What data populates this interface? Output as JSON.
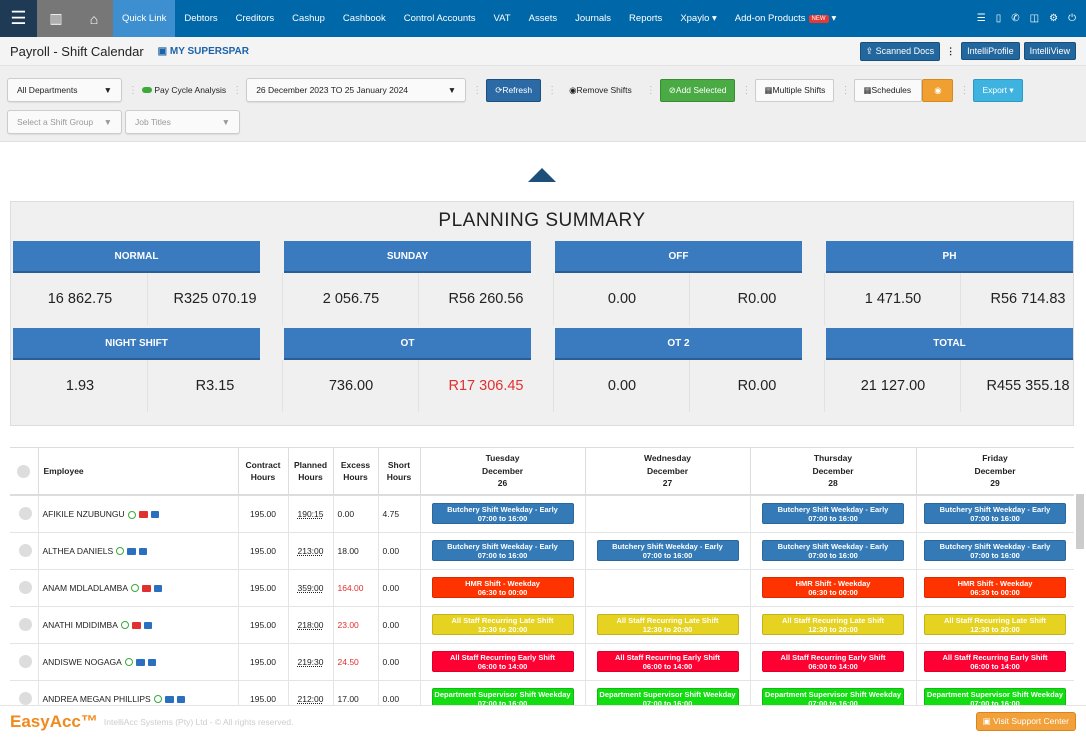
{
  "nav": {
    "items": [
      "Quick Link",
      "Debtors",
      "Creditors",
      "Cashup",
      "Cashbook",
      "Control Accounts",
      "VAT",
      "Assets",
      "Journals",
      "Reports",
      "Xpaylo ▾",
      "Add-on Products"
    ],
    "new_badge": "NEW",
    "addon_caret": "▾"
  },
  "title": {
    "page": "Payroll - Shift Calendar",
    "company": "MY SUPERSPAR",
    "scanned": "Scanned Docs",
    "profile": "IntelliProfile",
    "view": "IntelliView"
  },
  "toolbar": {
    "department": "All Departments",
    "pay_cycle": "Pay Cycle Analysis",
    "date_range": "26 December 2023 TO 25 January 2024",
    "refresh": "Refresh",
    "remove": "Remove Shifts",
    "add_selected": "Add Selected",
    "multiple": "Multiple Shifts",
    "schedules": "Schedules",
    "export": "Export",
    "shift_group_placeholder": "Select a Shift Group",
    "job_titles_placeholder": "Job Titles"
  },
  "summary": {
    "title": "PLANNING SUMMARY",
    "cards": [
      {
        "label": "NORMAL",
        "hours": "16 862.75",
        "amount": "R325 070.19"
      },
      {
        "label": "SUNDAY",
        "hours": "2 056.75",
        "amount": "R56 260.56"
      },
      {
        "label": "OFF",
        "hours": "0.00",
        "amount": "R0.00"
      },
      {
        "label": "PH",
        "hours": "1 471.50",
        "amount": "R56 714.83"
      },
      {
        "label": "NIGHT SHIFT",
        "hours": "1.93",
        "amount": "R3.15"
      },
      {
        "label": "OT",
        "hours": "736.00",
        "amount": "R17 306.45",
        "amount_highlight": true
      },
      {
        "label": "OT 2",
        "hours": "0.00",
        "amount": "R0.00"
      },
      {
        "label": "TOTAL",
        "hours": "21 127.00",
        "amount": "R455 355.18"
      }
    ]
  },
  "table": {
    "headers": {
      "employee": "Employee",
      "contract": "Contract Hours",
      "planned": "Planned Hours",
      "excess": "Excess Hours",
      "short": "Short Hours"
    },
    "days": [
      {
        "weekday": "Tuesday",
        "month": "December",
        "day": "26"
      },
      {
        "weekday": "Wednesday",
        "month": "December",
        "day": "27"
      },
      {
        "weekday": "Thursday",
        "month": "December",
        "day": "28"
      },
      {
        "weekday": "Friday",
        "month": "December",
        "day": "29"
      }
    ],
    "shift_types": {
      "butchery": {
        "name": "Butchery Shift Weekday - Early",
        "time": "07:00 to 16:00",
        "color": "#337ab7"
      },
      "hmr": {
        "name": "HMR Shift - Weekday",
        "time": "06:30 to 00:00",
        "color": "#ff3300"
      },
      "late": {
        "name": "All Staff Recurring Late Shift",
        "time": "12:30 to 20:00",
        "color": "#e6d220"
      },
      "early": {
        "name": "All Staff Recurring Early Shift",
        "time": "06:00 to 14:00",
        "color": "#ff0033"
      },
      "super": {
        "name": "Department Supervisor Shift Weekday",
        "time": "07:00 to 16:00",
        "color": "#11dd11"
      }
    },
    "rows": [
      {
        "name": "AFIKILE NZUBUNGU",
        "card_color": "#e03030",
        "contract": "195.00",
        "planned": "190:15",
        "excess": "0.00",
        "excess_red": false,
        "short": "4.75",
        "shifts": [
          "butchery",
          null,
          "butchery",
          "butchery"
        ]
      },
      {
        "name": "ALTHEA DANIELS",
        "card_color": "#2a6fc0",
        "contract": "195.00",
        "planned": "213:00",
        "excess": "18.00",
        "excess_red": false,
        "short": "0.00",
        "shifts": [
          "butchery",
          "butchery",
          "butchery",
          "butchery"
        ]
      },
      {
        "name": "ANAM MDLADLAMBA",
        "card_color": "#e03030",
        "contract": "195.00",
        "planned": "359:00",
        "excess": "164.00",
        "excess_red": true,
        "short": "0.00",
        "shifts": [
          "hmr",
          null,
          "hmr",
          "hmr"
        ]
      },
      {
        "name": "ANATHI MDIDIMBA",
        "card_color": "#e03030",
        "contract": "195.00",
        "planned": "218:00",
        "excess": "23.00",
        "excess_red": true,
        "short": "0.00",
        "shifts": [
          "late",
          "late",
          "late",
          "late"
        ]
      },
      {
        "name": "ANDISWE NOGAGA",
        "card_color": "#2a6fc0",
        "contract": "195.00",
        "planned": "219:30",
        "excess": "24.50",
        "excess_red": true,
        "short": "0.00",
        "shifts": [
          "early",
          "early",
          "early",
          "early"
        ]
      },
      {
        "name": "ANDREA MEGAN PHILLIPS",
        "card_color": "#2a6fc0",
        "contract": "195.00",
        "planned": "212:00",
        "excess": "17.00",
        "excess_red": false,
        "short": "0.00",
        "shifts": [
          "super",
          "super",
          "super",
          "super"
        ]
      }
    ]
  },
  "footer": {
    "logo": "EasyAcc™",
    "copyright": "IntelliAcc Systems (Pty) Ltd - © All rights reserved.",
    "support": "Visit Support Center"
  }
}
